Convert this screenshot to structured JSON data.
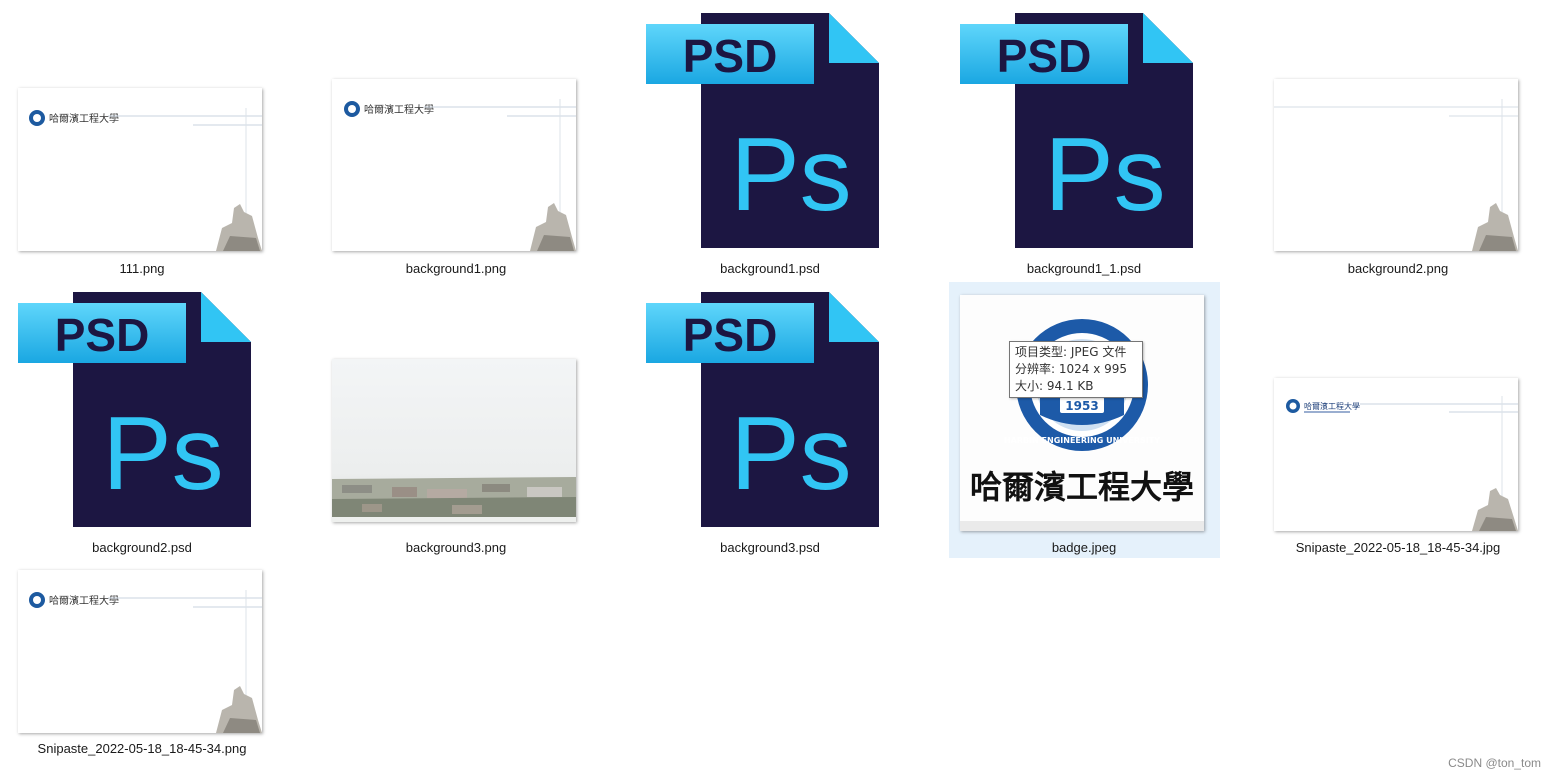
{
  "files": [
    {
      "name": "111.png",
      "kind": "letterhead-thumbnail"
    },
    {
      "name": "background1.png",
      "kind": "letterhead-thumbnail"
    },
    {
      "name": "background1.psd",
      "kind": "psd-icon"
    },
    {
      "name": "background1_1.psd",
      "kind": "psd-icon"
    },
    {
      "name": "background2.png",
      "kind": "letterhead-thumbnail"
    },
    {
      "name": "background2.psd",
      "kind": "psd-icon"
    },
    {
      "name": "background3.png",
      "kind": "campus-thumbnail"
    },
    {
      "name": "background3.psd",
      "kind": "psd-icon"
    },
    {
      "name": "badge.jpeg",
      "kind": "badge-thumbnail",
      "selected": true
    },
    {
      "name": "Snipaste_2022-05-18_18-45-34.jpg",
      "kind": "letterhead-thumbnail"
    },
    {
      "name": "Snipaste_2022-05-18_18-45-34.png",
      "kind": "letterhead-thumbnail"
    }
  ],
  "psd_icon": {
    "badge_text": "PSD",
    "glyph_text": "Ps",
    "colors": {
      "body": "#1c1642",
      "accent": "#31c5f4"
    }
  },
  "badge_thumb": {
    "year": "1953",
    "english_ring": "HARBIN ENGINEERING UNIVERSITY",
    "calligraphy": "哈爾濱工程大學"
  },
  "letterhead": {
    "school_name": "哈爾濱工程大學"
  },
  "tooltip": {
    "line1": "项目类型: JPEG 文件",
    "line2": "分辨率: 1024 x 995",
    "line3": "大小: 94.1 KB"
  },
  "watermark": "CSDN @ton_tom",
  "selection_color": "#e5f1fb"
}
